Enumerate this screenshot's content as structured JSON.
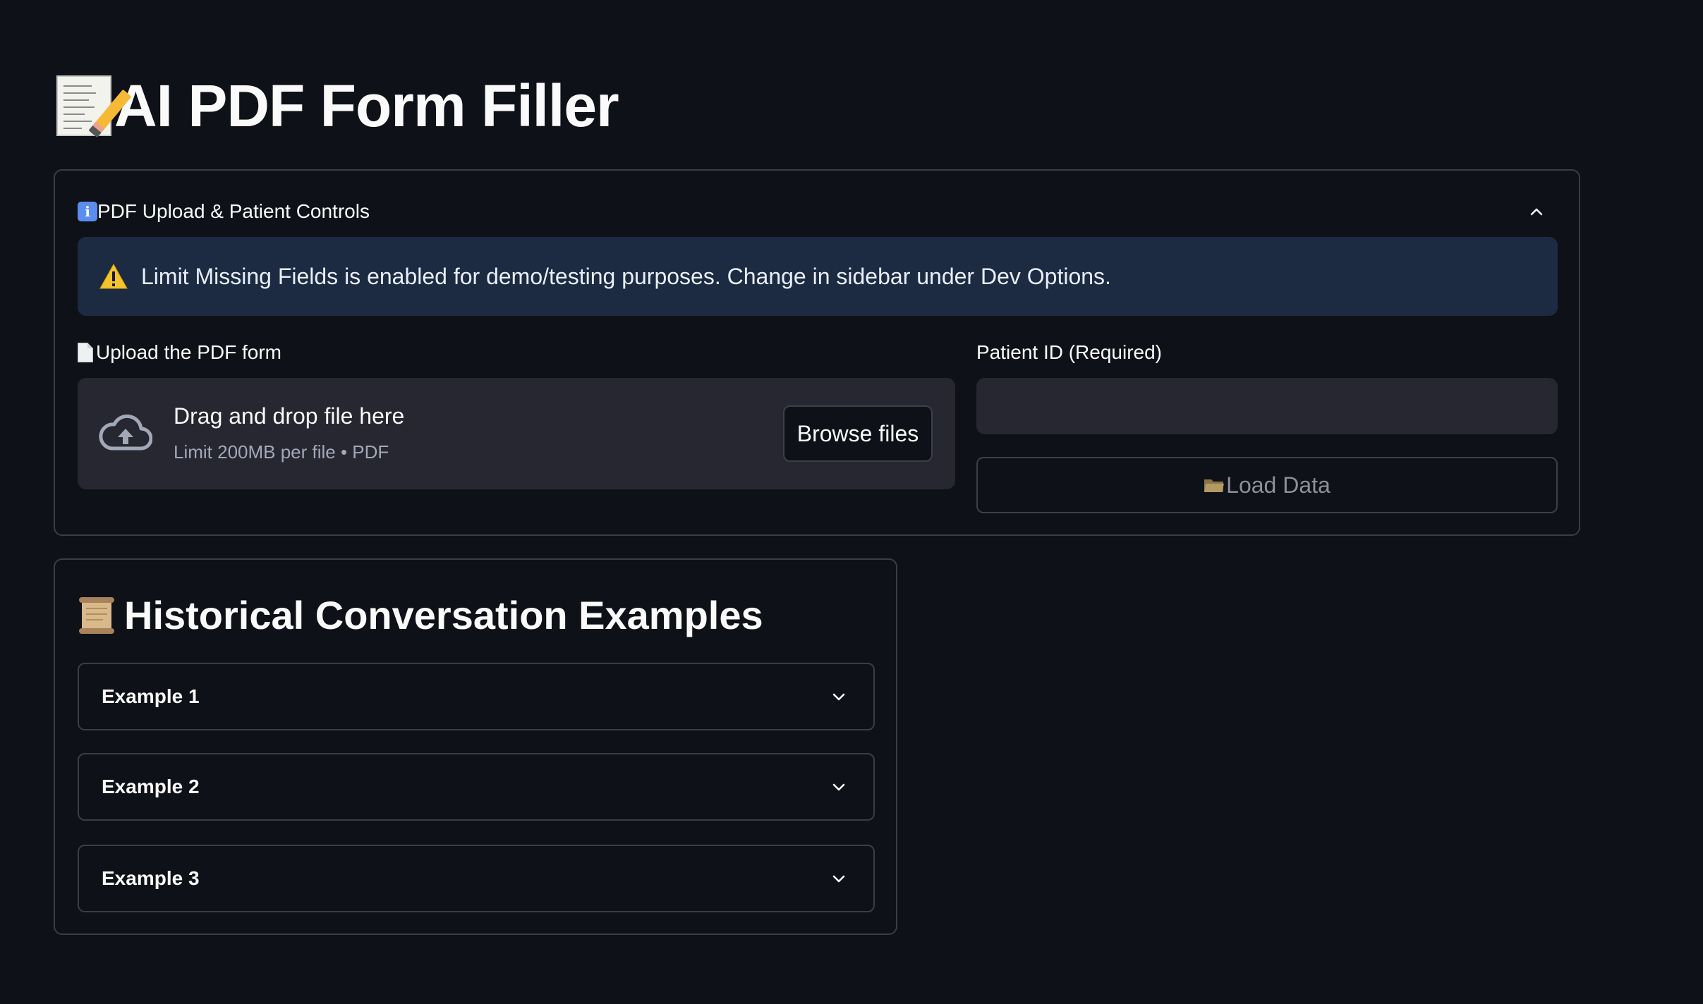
{
  "page": {
    "title": "AI PDF Form Filler",
    "title_icon": "memo-icon"
  },
  "expander": {
    "header": "PDF Upload & Patient Controls",
    "header_icon": "info-icon",
    "info_glyph": "i",
    "expanded": true,
    "warning": {
      "icon": "warning-icon",
      "text": "Limit Missing Fields is enabled for demo/testing purposes. Change in sidebar under Dev Options.",
      "background": "#1c2b42"
    },
    "upload": {
      "label": "Upload the PDF form",
      "label_icon": "document-icon",
      "dropzone_title": "Drag and drop file here",
      "dropzone_sub": "Limit 200MB per file • PDF",
      "browse_label": "Browse files",
      "icon": "cloud-upload-icon"
    },
    "patient": {
      "label": "Patient ID (Required)",
      "value": "",
      "placeholder": ""
    },
    "load_button": {
      "label": "Load Data",
      "icon": "folder-icon",
      "disabled": true
    }
  },
  "history": {
    "title": "Historical Conversation Examples",
    "icon": "scroll-icon",
    "examples": [
      {
        "label": "Example 1"
      },
      {
        "label": "Example 2"
      },
      {
        "label": "Example 3"
      }
    ]
  },
  "colors": {
    "background": "#0e1117",
    "surface": "#262730",
    "border": "#3a3d46",
    "text": "#fafafa",
    "muted": "#a3a8b8"
  }
}
